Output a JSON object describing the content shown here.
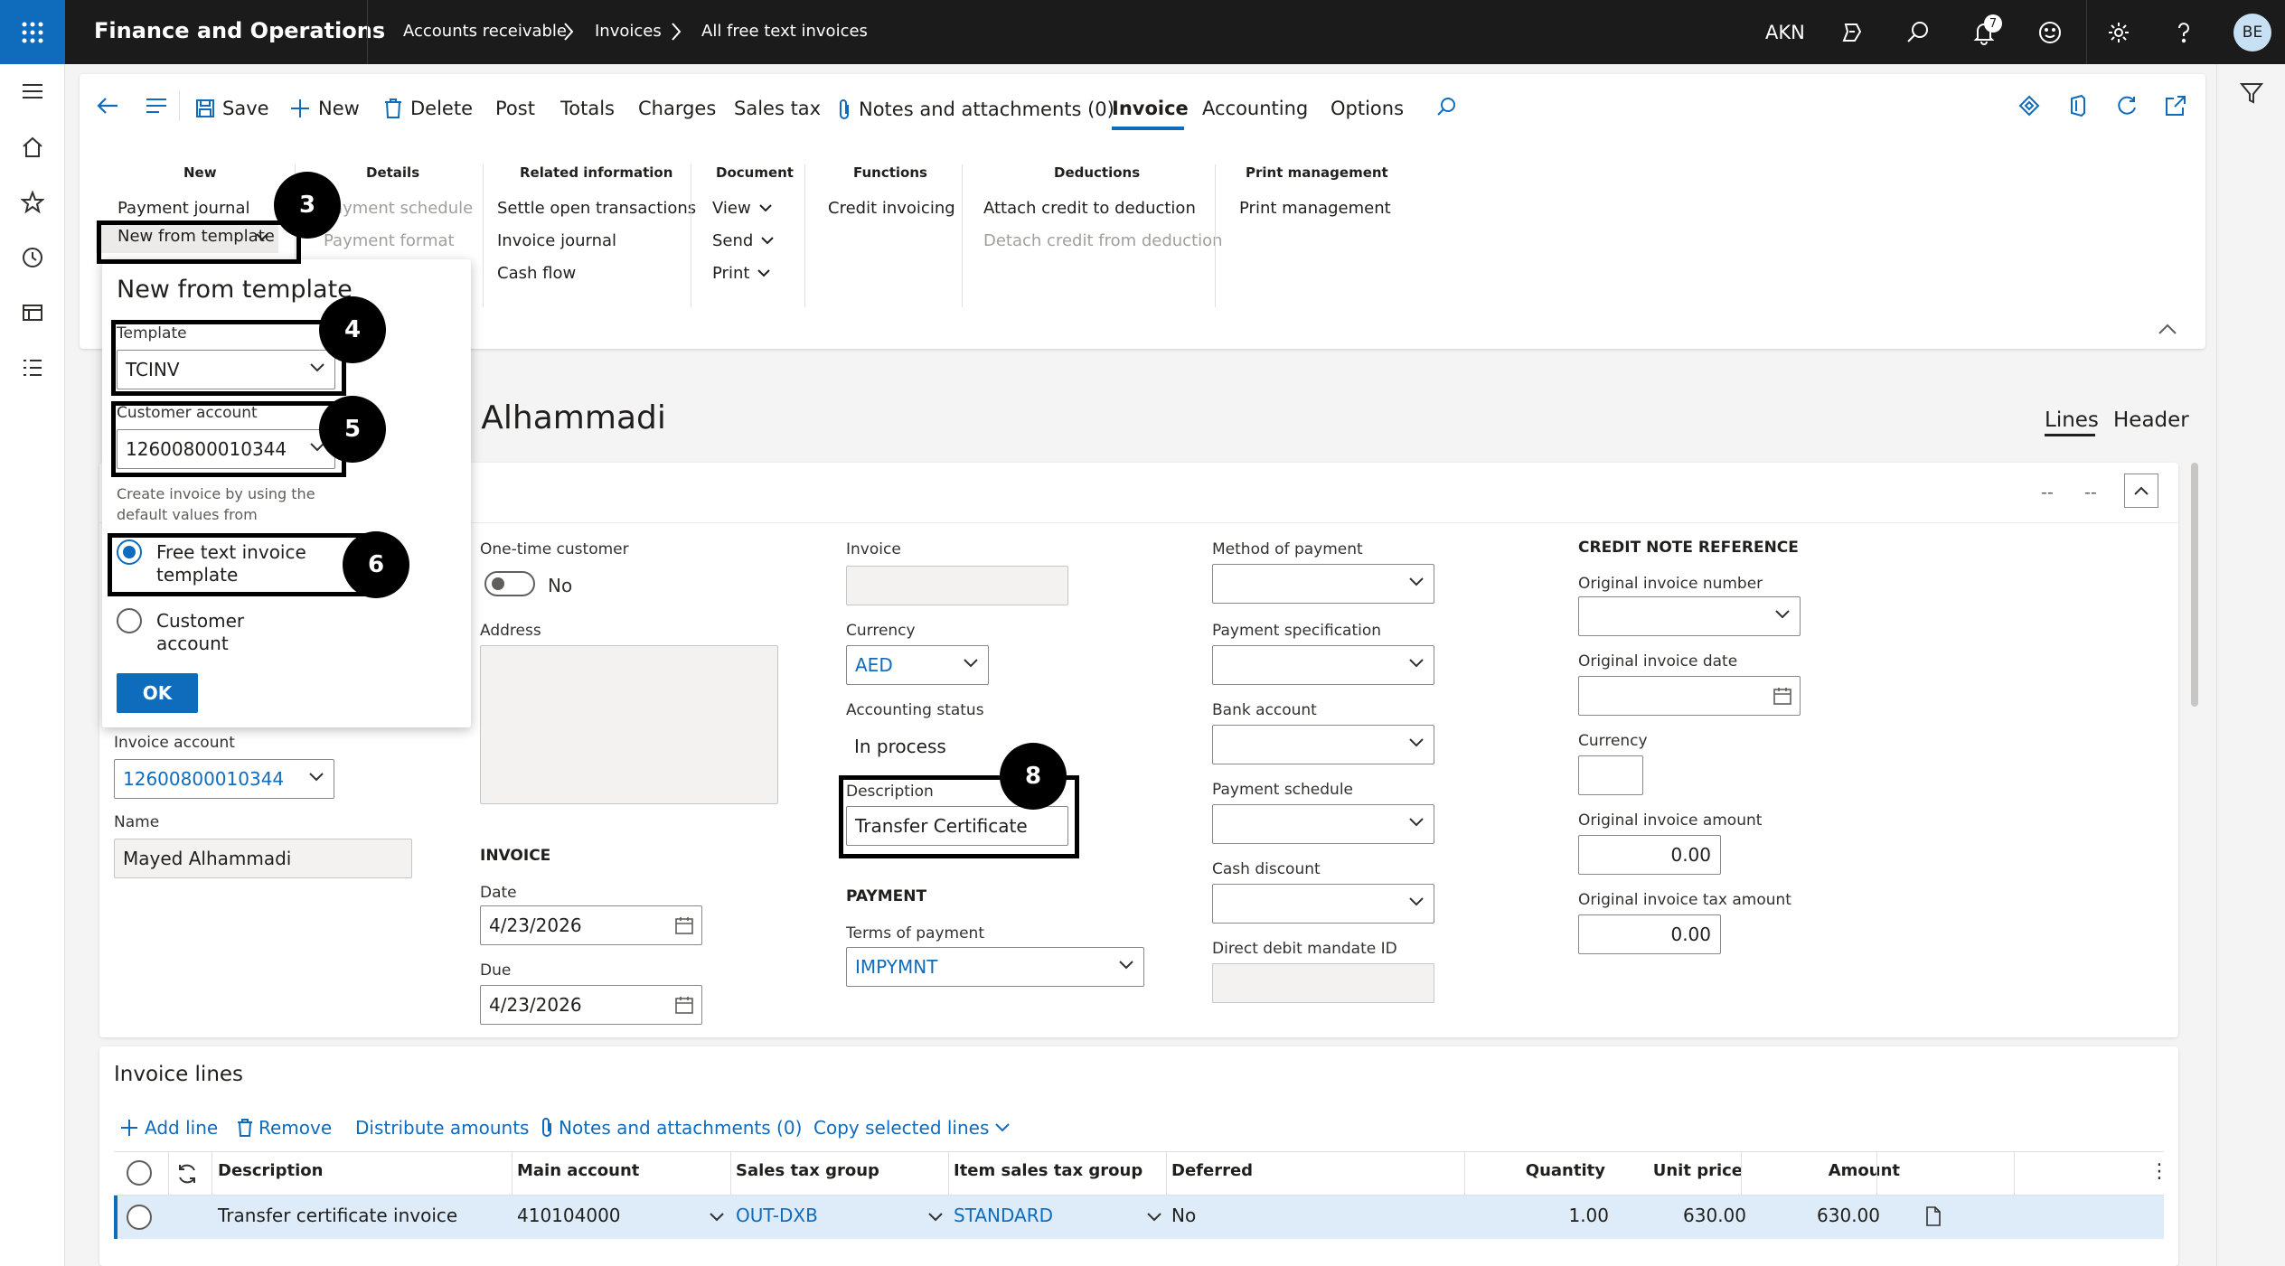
{
  "app": {
    "title": "Finance and Operations",
    "company": "AKN",
    "user_initials": "BE",
    "notification_count": "7"
  },
  "breadcrumb": [
    "Accounts receivable",
    "Invoices",
    "All free text invoices"
  ],
  "toolbar": {
    "save": "Save",
    "new": "New",
    "delete": "Delete",
    "post": "Post",
    "totals": "Totals",
    "charges": "Charges",
    "sales_tax": "Sales tax",
    "notes": "Notes and attachments (0)",
    "tab_invoice": "Invoice",
    "tab_accounting": "Accounting",
    "tab_options": "Options"
  },
  "ribbon": {
    "new": {
      "header": "New",
      "payment_journal": "Payment journal",
      "new_from_template": "New from template"
    },
    "details": {
      "header": "Details",
      "payment_schedule": "Payment schedule",
      "payment_format": "Payment format"
    },
    "related": {
      "header": "Related information",
      "settle": "Settle open transactions",
      "invoice_journal": "Invoice journal",
      "cash_flow": "Cash flow"
    },
    "document": {
      "header": "Document",
      "view": "View",
      "send": "Send",
      "print": "Print"
    },
    "functions": {
      "header": "Functions",
      "credit_invoicing": "Credit invoicing"
    },
    "deductions": {
      "header": "Deductions",
      "attach": "Attach credit to deduction",
      "detach": "Detach credit from deduction"
    },
    "print_mgmt": {
      "header": "Print management",
      "print_management": "Print management"
    }
  },
  "flyout": {
    "title": "New from template",
    "template_label": "Template",
    "template_value": "TCINV",
    "customer_label": "Customer account",
    "customer_value": "12600800010344",
    "info": "Create invoice by using the default values from",
    "option_template": "Free text invoice template",
    "option_customer": "Customer account",
    "ok": "OK"
  },
  "page": {
    "title_fragment": "d Alhammadi",
    "tab_lines": "Lines",
    "tab_header": "Header",
    "nav_prev": "--",
    "nav_next": "--"
  },
  "form": {
    "invoice_account_label": "Invoice account",
    "invoice_account": "12600800010344",
    "name_label": "Name",
    "name": "Mayed Alhammadi",
    "one_time_label": "One-time customer",
    "one_time_value": "No",
    "address_label": "Address",
    "invoice_section": "INVOICE",
    "date_label": "Date",
    "date": "4/23/2026",
    "due_label": "Due",
    "due": "4/23/2026",
    "invoice_label": "Invoice",
    "invoice": "",
    "currency_label": "Currency",
    "currency": "AED",
    "acc_status_label": "Accounting status",
    "acc_status": "In process",
    "description_label": "Description",
    "description": "Transfer Certificate",
    "payment_section": "PAYMENT",
    "terms_label": "Terms of payment",
    "terms": "IMPYMNT",
    "method_label": "Method of payment",
    "pay_spec_label": "Payment specification",
    "bank_label": "Bank account",
    "pay_sched_label": "Payment schedule",
    "cash_disc_label": "Cash discount",
    "ddm_label": "Direct debit mandate ID",
    "credit_section": "CREDIT NOTE REFERENCE",
    "orig_num_label": "Original invoice number",
    "orig_date_label": "Original invoice date",
    "cn_currency_label": "Currency",
    "orig_amount_label": "Original invoice amount",
    "orig_amount": "0.00",
    "orig_tax_label": "Original invoice tax amount",
    "orig_tax": "0.00"
  },
  "lines": {
    "title": "Invoice lines",
    "toolbar": {
      "add": "Add line",
      "remove": "Remove",
      "distribute": "Distribute amounts",
      "notes": "Notes and attachments (0)",
      "copy": "Copy selected lines"
    },
    "columns": [
      "Description",
      "Main account",
      "Sales tax group",
      "Item sales tax group",
      "Deferred",
      "Quantity",
      "Unit price",
      "Amount"
    ],
    "rows": [
      {
        "description": "Transfer certificate invoice",
        "main_account": "410104000",
        "sales_tax_group": "OUT-DXB",
        "item_sales_tax_group": "STANDARD",
        "deferred": "No",
        "quantity": "1.00",
        "unit_price": "630.00",
        "amount": "630.00"
      }
    ]
  },
  "badges": {
    "b3": "3",
    "b4": "4",
    "b5": "5",
    "b6": "6",
    "b8": "8"
  },
  "colors": {
    "accent": "#0f6cbd",
    "topbar": "#1b1b1b",
    "selected_row": "#deecf9"
  }
}
